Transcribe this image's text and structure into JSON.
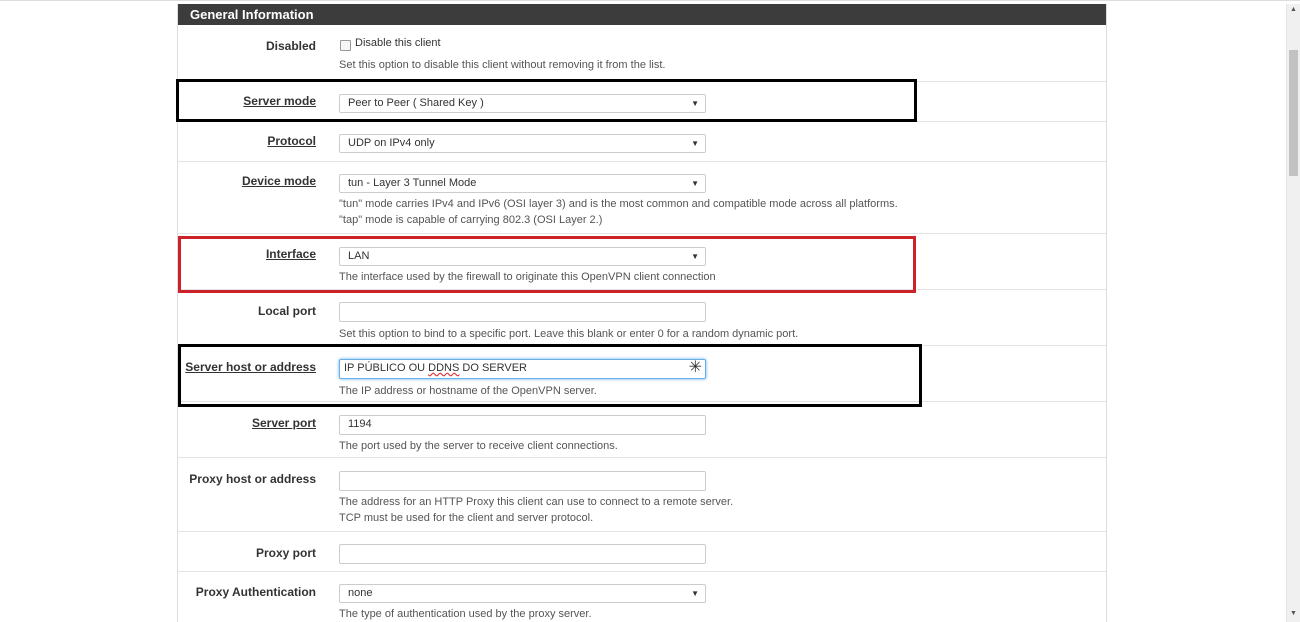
{
  "section_title": "General Information",
  "fields": {
    "disabled": {
      "label": "Disabled",
      "checkbox_label": "Disable this client",
      "help": "Set this option to disable this client without removing it from the list."
    },
    "server_mode": {
      "label": "Server mode",
      "value": "Peer to Peer ( Shared Key )"
    },
    "protocol": {
      "label": "Protocol",
      "value": "UDP on IPv4 only"
    },
    "device_mode": {
      "label": "Device mode",
      "value": "tun - Layer 3 Tunnel Mode",
      "help1": "\"tun\" mode carries IPv4 and IPv6 (OSI layer 3) and is the most common and compatible mode across all platforms.",
      "help2": "\"tap\" mode is capable of carrying 802.3 (OSI Layer 2.)"
    },
    "interface": {
      "label": "Interface",
      "value": "LAN",
      "help": "The interface used by the firewall to originate this OpenVPN client connection"
    },
    "local_port": {
      "label": "Local port",
      "value": "",
      "help": "Set this option to bind to a specific port. Leave this blank or enter 0 for a random dynamic port."
    },
    "server_host": {
      "label": "Server host or address",
      "value_part1": "IP PÚBLICO OU ",
      "value_part2": "DDNS",
      "value_part3": " DO SERVER",
      "help": "The IP address or hostname of the OpenVPN server."
    },
    "server_port": {
      "label": "Server port",
      "value": "1194",
      "help": "The port used by the server to receive client connections."
    },
    "proxy_host": {
      "label": "Proxy host or address",
      "value": "",
      "help1": "The address for an HTTP Proxy this client can use to connect to a remote server.",
      "help2": "TCP must be used for the client and server protocol."
    },
    "proxy_port": {
      "label": "Proxy port",
      "value": ""
    },
    "proxy_auth": {
      "label": "Proxy Authentication",
      "value": "none",
      "help": "The type of authentication used by the proxy server."
    }
  },
  "icons": {
    "select_caret": "caret-down-icon",
    "required": "asterisk-icon"
  },
  "colors": {
    "header_bg": "#3c3c3c",
    "highlight_black": "#000000",
    "highlight_red": "#cc2229"
  }
}
